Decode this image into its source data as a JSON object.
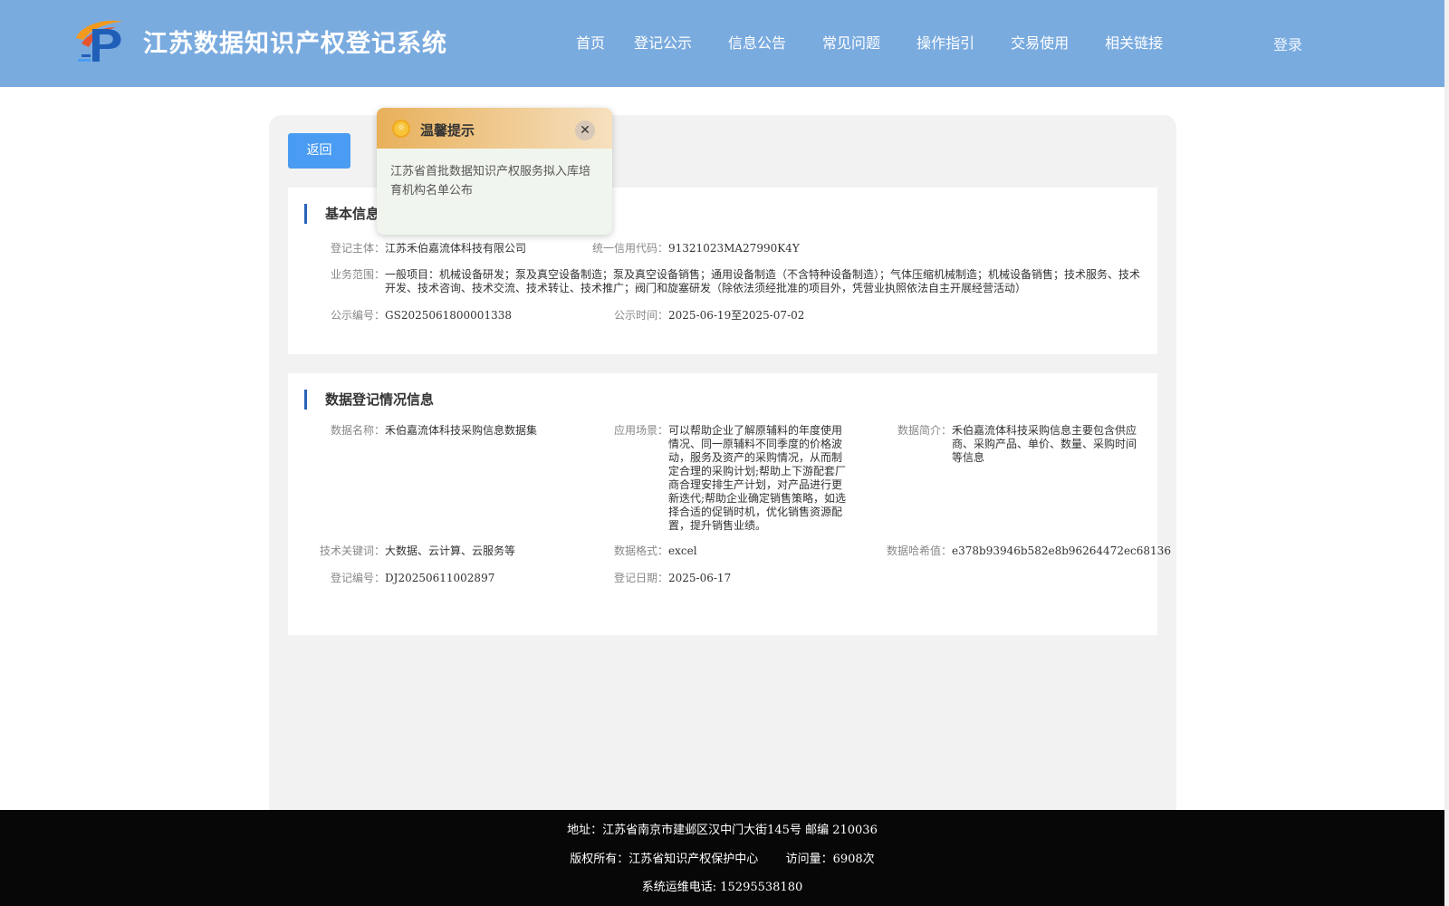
{
  "header": {
    "title": "江苏数据知识产权登记系统",
    "nav": [
      "首页",
      "登记公示",
      "信息公告",
      "常见问题",
      "操作指引",
      "交易使用",
      "相关链接"
    ],
    "login": "登录"
  },
  "main": {
    "back_label": "返回",
    "basic": {
      "title": "基本信息",
      "entity_label": "登记主体：",
      "entity": "江苏禾伯嘉流体科技有限公司",
      "credit_label": "统一信用代码：",
      "credit": "91321023MA27990K4Y",
      "scope_label": "业务范围：",
      "scope": "一般项目：机械设备研发；泵及真空设备制造；泵及真空设备销售；通用设备制造（不含特种设备制造）；气体压缩机械制造；机械设备销售；技术服务、技术开发、技术咨询、技术交流、技术转让、技术推广；阀门和旋塞研发（除依法须经批准的项目外，凭营业执照依法自主开展经营活动）",
      "pubno_label": "公示编号：",
      "pubno": "GS2025061800001338",
      "pubtime_label": "公示时间：",
      "pubtime": "2025-06-19至2025-07-02"
    },
    "data": {
      "title": "数据登记情况信息",
      "name_label": "数据名称：",
      "name": "禾伯嘉流体科技采购信息数据集",
      "scene_label": "应用场景：",
      "scene": "可以帮助企业了解原辅料的年度使用情况、同一原辅料不同季度的价格波动，服务及资产的采购情况，从而制定合理的采购计划;帮助上下游配套厂商合理安排生产计划，对产品进行更新迭代;帮助企业确定销售策略，如选择合适的促销时机，优化销售资源配置，提升销售业绩。",
      "intro_label": "数据简介：",
      "intro": "禾伯嘉流体科技采购信息主要包含供应商、采购产品、单价、数量、采购时间等信息",
      "keywords_label": "技术关键词：",
      "keywords": "大数据、云计算、云服务等",
      "format_label": "数据格式：",
      "format": "excel",
      "hash_label": "数据哈希值：",
      "hash": "e378b93946b582e8b96264472ec68136",
      "regno_label": "登记编号：",
      "regno": "DJ20250611002897",
      "regdate_label": "登记日期：",
      "regdate": "2025-06-17"
    }
  },
  "popup": {
    "title": "温馨提示",
    "body": "江苏省首批数据知识产权服务拟入库培育机构名单公布",
    "close_icon": "close-icon",
    "icon": "bulb-icon"
  },
  "footer": {
    "address": "地址：江苏省南京市建邺区汉中门大街145号 邮编 210036",
    "copyright": "版权所有：江苏省知识产权保护中心",
    "visits": "访问量：6908次",
    "phone": "系统运维电话: 15295538180"
  },
  "colors": {
    "header_bg": "#7aabdf",
    "accent": "#4a9cf2",
    "footer_bg": "#070707"
  }
}
